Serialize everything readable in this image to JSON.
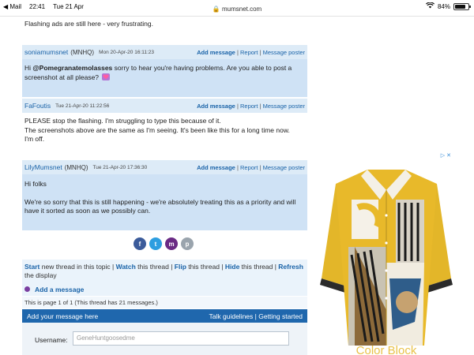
{
  "status_bar": {
    "back_app": "◀ Mail",
    "time": "22:41",
    "date": "Tue 21 Apr",
    "url": "mumsnet.com",
    "battery": "84%",
    "battery_level": 0.84
  },
  "top_text": "Flashing ads are still here - very frustrating.",
  "actions": {
    "add": "Add message",
    "sep1": " | ",
    "report": "Report",
    "sep2": " | ",
    "msg_poster": "Message poster"
  },
  "messages": [
    {
      "user": "soniamumsnet",
      "tag": "(MNHQ)",
      "date": "Mon 20-Apr-20 16:11:23",
      "mention": "@Pomegranatemolasses",
      "text_before": "Hi ",
      "text_after": " sorry to hear you're having problems. Are you able to post a screenshot at all please?"
    },
    {
      "user": "FaFoutis",
      "tag": "",
      "date": "Tue 21-Apr-20 11:22:56",
      "lines": [
        "PLEASE stop the flashing. I'm struggling to type this because of it.",
        "The screenshots above are the same as I'm seeing. It's been like this for a long time now.",
        "I'm off."
      ]
    },
    {
      "user": "LilyMumsnet",
      "tag": "(MNHQ)",
      "date": "Tue 21-Apr-20 17:36:30",
      "lines": [
        "Hi folks",
        "We're so sorry that this is still happening - we're absolutely treating this as a priority and will have it sorted as soon as we possibly can."
      ]
    }
  ],
  "social": [
    "f",
    "t",
    "m",
    "p"
  ],
  "thread_bar": {
    "start": "Start",
    "start_text": " new thread in this topic | ",
    "watch": "Watch",
    "watch_text": " this thread | ",
    "flip": "Flip",
    "flip_text": " this thread | ",
    "hide": "Hide",
    "hide_text": " this thread | ",
    "refresh": "Refresh",
    "refresh_text": " the display"
  },
  "add_message": "Add a message",
  "page_info": "This is page 1 of 1 (This thread has 21 messages.)",
  "reply_bar": {
    "left": "Add your message here",
    "guidelines": "Talk guidelines",
    "sep": " | ",
    "getting_started": "Getting started"
  },
  "form": {
    "username_label": "Username:",
    "username_value": "GeneHuntgoosedme"
  },
  "ad": {
    "headline": "Color Block"
  }
}
